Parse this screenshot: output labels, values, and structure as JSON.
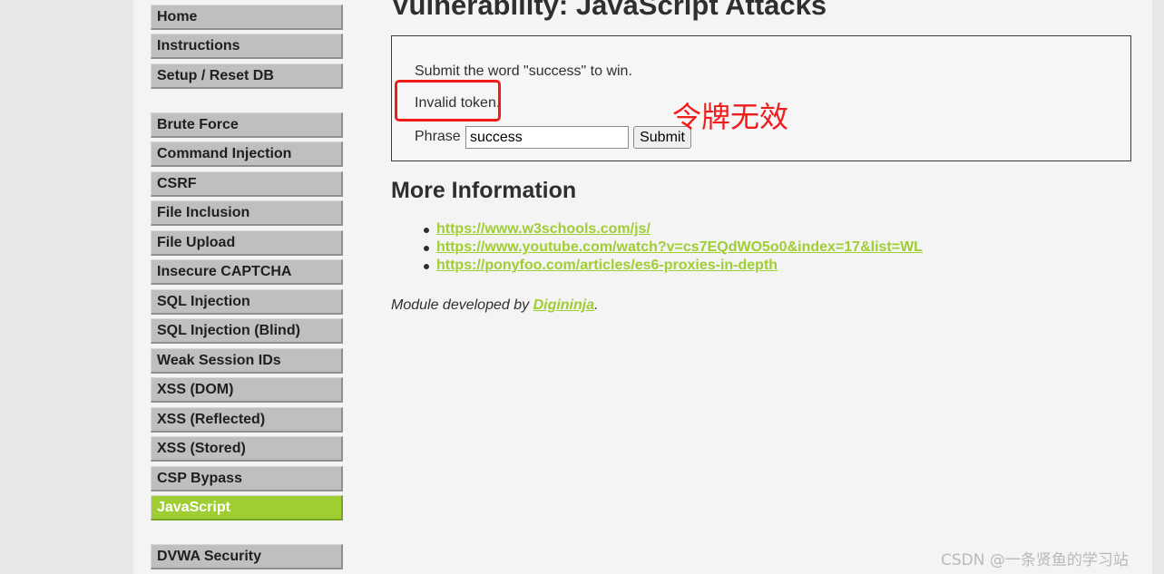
{
  "menu": {
    "items": [
      {
        "label": "Home",
        "active": false
      },
      {
        "label": "Instructions",
        "active": false
      },
      {
        "label": "Setup / Reset DB",
        "active": false
      },
      {
        "label": "Brute Force",
        "active": false
      },
      {
        "label": "Command Injection",
        "active": false
      },
      {
        "label": "CSRF",
        "active": false
      },
      {
        "label": "File Inclusion",
        "active": false
      },
      {
        "label": "File Upload",
        "active": false
      },
      {
        "label": "Insecure CAPTCHA",
        "active": false
      },
      {
        "label": "SQL Injection",
        "active": false
      },
      {
        "label": "SQL Injection (Blind)",
        "active": false
      },
      {
        "label": "Weak Session IDs",
        "active": false
      },
      {
        "label": "XSS (DOM)",
        "active": false
      },
      {
        "label": "XSS (Reflected)",
        "active": false
      },
      {
        "label": "XSS (Stored)",
        "active": false
      },
      {
        "label": "CSP Bypass",
        "active": false
      },
      {
        "label": "JavaScript",
        "active": true
      },
      {
        "label": "DVWA Security",
        "active": false
      }
    ]
  },
  "main": {
    "title": "Vulnerability: JavaScript Attacks",
    "instructions": "Submit the word \"success\" to win.",
    "message": "Invalid token.",
    "phrase_label": "Phrase",
    "phrase_value": "success",
    "submit_label": "Submit",
    "annotation": "令牌无效",
    "more_info_title": "More Information",
    "links": [
      "https://www.w3schools.com/js/",
      "https://www.youtube.com/watch?v=cs7EQdWO5o0&index=17&list=WL",
      "https://ponyfoo.com/articles/es6-proxies-in-depth"
    ],
    "credit_prefix": "Module developed by ",
    "credit_link": "Digininja",
    "credit_suffix": "."
  },
  "watermark": "CSDN @一条贤鱼的学习站",
  "colors": {
    "accent_green": "#9fce32",
    "annotation_red": "#f31a1a",
    "menu_gray": "#bfbfbf"
  }
}
